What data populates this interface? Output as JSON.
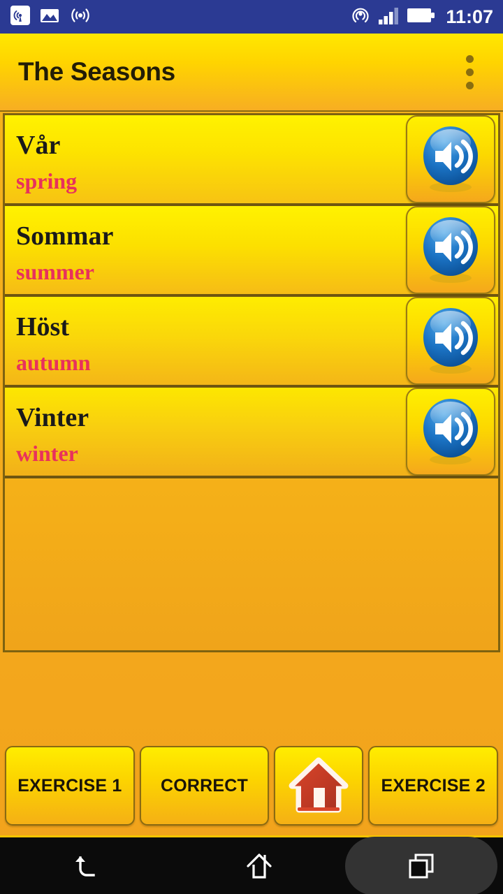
{
  "status_bar": {
    "background_color": "#2B3A93",
    "left_icons": [
      {
        "name": "broadcast-tower-icon",
        "label": "broadcast"
      },
      {
        "name": "picture-icon",
        "label": "screenshot"
      },
      {
        "name": "wifi-waves-icon",
        "label": "wifi"
      }
    ],
    "right_icons": [
      {
        "name": "hotspot-icon",
        "label": "hotspot"
      },
      {
        "name": "signal-bars-icon",
        "label": "signal",
        "bars_filled": 3,
        "bars_total": 4
      },
      {
        "name": "battery-full-icon",
        "label": "battery",
        "level": "full"
      }
    ],
    "clock": "11:07"
  },
  "title_bar": {
    "title": "The Seasons",
    "overflow_menu_name": "more-options",
    "text_color": "#231D06",
    "gradient_top": "#FFE800",
    "gradient_bottom": "#F7AE22"
  },
  "list": {
    "rows": [
      {
        "word": "Vår",
        "translation": "spring",
        "speaker_icon": "speaker-icon"
      },
      {
        "word": "Sommar",
        "translation": "summer",
        "speaker_icon": "speaker-icon"
      },
      {
        "word": "Höst",
        "translation": "autumn",
        "speaker_icon": "speaker-icon"
      },
      {
        "word": "Vinter",
        "translation": "winter",
        "speaker_icon": "speaker-icon"
      }
    ],
    "word_color": "#1A1A1A",
    "translation_color": "#E8315C",
    "divider_color": "#6E5510"
  },
  "bottom_bar": {
    "buttons": [
      {
        "label": "EXERCISE 1",
        "name": "exercise-1-button",
        "type": "text"
      },
      {
        "label": "CORRECT",
        "name": "correct-button",
        "type": "text"
      },
      {
        "label": "",
        "name": "home-button",
        "type": "icon",
        "icon": "house-icon"
      },
      {
        "label": "EXERCISE 2",
        "name": "exercise-2-button",
        "type": "text"
      }
    ],
    "text_color": "#1A1408"
  },
  "nav_bar": {
    "background_color": "#0B0B0B",
    "items": [
      {
        "name": "nav-back-icon",
        "label": "Back"
      },
      {
        "name": "nav-home-icon",
        "label": "Home"
      },
      {
        "name": "nav-recents-icon",
        "label": "Recents",
        "highlighted": true
      }
    ]
  }
}
